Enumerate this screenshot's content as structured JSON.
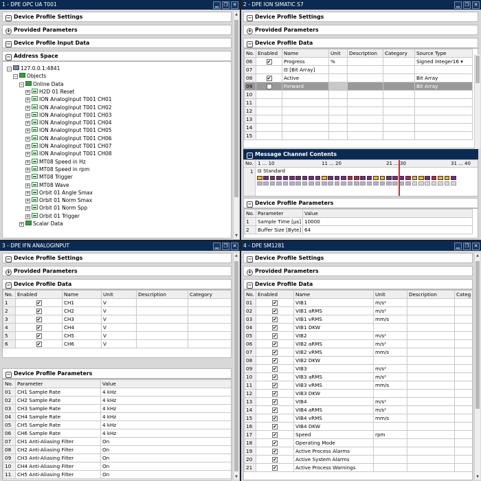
{
  "p1": {
    "title": "1 - DPE OPC UA T001",
    "sections": [
      "Device Profile Settings",
      "Provided Parameters",
      "Device Profile Input Data",
      "Address Space"
    ],
    "tree": [
      {
        "label": "127.0.0.1:4841",
        "level": 0,
        "expander": "−",
        "icon": "server-icon"
      },
      {
        "label": "Objects",
        "level": 1,
        "expander": "−",
        "icon": "folder-icon"
      },
      {
        "label": "Online Data",
        "level": 2,
        "expander": "−",
        "icon": "folder-icon"
      },
      {
        "label": "H2D 01 Reset",
        "level": 3,
        "expander": "+",
        "icon": "variable-icon"
      },
      {
        "label": "ION AnalogInput T001 CH01",
        "level": 3,
        "expander": "+",
        "icon": "variable-icon"
      },
      {
        "label": "ION AnalogInput T001 CH02",
        "level": 3,
        "expander": "+",
        "icon": "variable-icon"
      },
      {
        "label": "ION AnalogInput T001 CH03",
        "level": 3,
        "expander": "+",
        "icon": "variable-icon"
      },
      {
        "label": "ION AnalogInput T001 CH04",
        "level": 3,
        "expander": "+",
        "icon": "variable-icon"
      },
      {
        "label": "ION AnalogInput T001 CH05",
        "level": 3,
        "expander": "+",
        "icon": "variable-icon"
      },
      {
        "label": "ION AnalogInput T001 CH06",
        "level": 3,
        "expander": "+",
        "icon": "variable-icon"
      },
      {
        "label": "ION AnalogInput T001 CH07",
        "level": 3,
        "expander": "+",
        "icon": "variable-icon"
      },
      {
        "label": "ION AnalogInput T001 CH08",
        "level": 3,
        "expander": "+",
        "icon": "variable-icon"
      },
      {
        "label": "MT08 Speed in Hz",
        "level": 3,
        "expander": "+",
        "icon": "variable-icon"
      },
      {
        "label": "MT08 Speed in rpm",
        "level": 3,
        "expander": "+",
        "icon": "variable-icon"
      },
      {
        "label": "MT08 Trigger",
        "level": 3,
        "expander": "+",
        "icon": "variable-icon"
      },
      {
        "label": "MT08 Wave",
        "level": 3,
        "expander": "+",
        "icon": "variable-icon"
      },
      {
        "label": "Orbit 01 Angle Smax",
        "level": 3,
        "expander": "+",
        "icon": "variable-icon"
      },
      {
        "label": "Orbit 01 Norm Smax",
        "level": 3,
        "expander": "+",
        "icon": "variable-icon"
      },
      {
        "label": "Orbit 01 Norm Spp",
        "level": 3,
        "expander": "+",
        "icon": "variable-icon"
      },
      {
        "label": "Orbit 01 Trigger",
        "level": 3,
        "expander": "+",
        "icon": "variable-icon"
      },
      {
        "label": "Scalar Data",
        "level": 2,
        "expander": "+",
        "icon": "folder-icon"
      }
    ]
  },
  "p2": {
    "title": "2 - DPE ION SIMATIC S7",
    "sections": [
      "Device Profile Settings",
      "Provided Parameters",
      "Device Profile Data",
      "Message Channel Contents",
      "Device Profile Parameters"
    ],
    "headers": [
      "No.",
      "Enabled",
      "Name",
      "Unit",
      "Description",
      "Category",
      "Source Type"
    ],
    "rows": [
      {
        "no": "06",
        "enabled": true,
        "name": "Progress",
        "unit": "%",
        "desc": "",
        "cat": "",
        "src": "Signed Integer16 ▾"
      },
      {
        "no": "07",
        "enabled": false,
        "name": "⊟ [Bit Array]",
        "unit": "",
        "desc": "",
        "cat": "",
        "src": ""
      },
      {
        "no": "08",
        "enabled": true,
        "name": "Active",
        "unit": "",
        "desc": "",
        "cat": "",
        "src": "Bit Array"
      },
      {
        "no": "09",
        "enabled": true,
        "name": "Forward",
        "unit": "",
        "desc": "",
        "cat": "",
        "src": "Bit Array",
        "selected": true
      },
      {
        "no": "10",
        "enabled": false,
        "name": "",
        "unit": "",
        "desc": "",
        "cat": "",
        "src": ""
      },
      {
        "no": "11",
        "enabled": false,
        "name": "",
        "unit": "",
        "desc": "",
        "cat": "",
        "src": ""
      },
      {
        "no": "12",
        "enabled": false,
        "name": "",
        "unit": "",
        "desc": "",
        "cat": "",
        "src": ""
      },
      {
        "no": "13",
        "enabled": false,
        "name": "",
        "unit": "",
        "desc": "",
        "cat": "",
        "src": ""
      },
      {
        "no": "14",
        "enabled": false,
        "name": "",
        "unit": "",
        "desc": "",
        "cat": "",
        "src": ""
      },
      {
        "no": "15",
        "enabled": false,
        "name": "",
        "unit": "",
        "desc": "",
        "cat": "",
        "src": ""
      }
    ],
    "channel": {
      "no_label": "No.",
      "ranges": [
        "1 ... 10",
        "11 ... 20",
        "21 ... 30",
        "31 ... 40"
      ],
      "row_no": "1",
      "row_label": "⊟ Standard"
    },
    "param_headers": [
      "No.",
      "Parameter",
      "Value"
    ],
    "params": [
      {
        "no": "1",
        "param": "Sample Time [µs]",
        "value": "10000"
      },
      {
        "no": "2",
        "param": "Buffer Size [Byte]",
        "value": "64"
      }
    ]
  },
  "p3": {
    "title": "3 - DPE IFN ANALOGINPUT",
    "sections": [
      "Device Profile Settings",
      "Provided Parameters",
      "Device Profile Data",
      "Device Profile Parameters"
    ],
    "headers": [
      "No.",
      "Enabled",
      "Name",
      "Unit",
      "Description",
      "Category"
    ],
    "rows": [
      {
        "no": "1",
        "name": "CH1",
        "unit": "V"
      },
      {
        "no": "2",
        "name": "CH2",
        "unit": "V"
      },
      {
        "no": "3",
        "name": "CH3",
        "unit": "V"
      },
      {
        "no": "4",
        "name": "CH4",
        "unit": "V"
      },
      {
        "no": "5",
        "name": "CH5",
        "unit": "V"
      },
      {
        "no": "6",
        "name": "CH6",
        "unit": "V"
      }
    ],
    "param_headers": [
      "No.",
      "Parameter",
      "Value"
    ],
    "params": [
      {
        "no": "01",
        "param": "CH1 Sample Rate",
        "value": "4 kHz"
      },
      {
        "no": "02",
        "param": "CH2 Sample Rate",
        "value": "4 kHz"
      },
      {
        "no": "03",
        "param": "CH3 Sample Rate",
        "value": "4 kHz"
      },
      {
        "no": "04",
        "param": "CH4 Sample Rate",
        "value": "4 kHz"
      },
      {
        "no": "05",
        "param": "CH5 Sample Rate",
        "value": "4 kHz"
      },
      {
        "no": "06",
        "param": "CH6 Sample Rate",
        "value": "4 kHz"
      },
      {
        "no": "07",
        "param": "CH1 Anti-Aliasing Filter",
        "value": "On"
      },
      {
        "no": "08",
        "param": "CH2 Anti-Aliasing Filter",
        "value": "On"
      },
      {
        "no": "09",
        "param": "CH3 Anti-Aliasing Filter",
        "value": "On"
      },
      {
        "no": "10",
        "param": "CH4 Anti-Aliasing Filter",
        "value": "On"
      },
      {
        "no": "11",
        "param": "CH5 Anti-Aliasing Filter",
        "value": "On"
      }
    ]
  },
  "p4": {
    "title": "4 - DPE SM1281",
    "sections": [
      "Device Profile Settings",
      "Provided Parameters",
      "Device Profile Data"
    ],
    "headers": [
      "No.",
      "Enabled",
      "Name",
      "Unit",
      "Description",
      "Categ"
    ],
    "rows": [
      {
        "no": "01",
        "name": "VIB1",
        "unit": "m/s²"
      },
      {
        "no": "02",
        "name": "VIB1 aRMS",
        "unit": "m/s²"
      },
      {
        "no": "03",
        "name": "VIB1 vRMS",
        "unit": "mm/s"
      },
      {
        "no": "04",
        "name": "VIB1 DKW",
        "unit": ""
      },
      {
        "no": "05",
        "name": "VIB2",
        "unit": "m/s²"
      },
      {
        "no": "06",
        "name": "VIB2 aRMS",
        "unit": "m/s²"
      },
      {
        "no": "07",
        "name": "VIB2 vRMS",
        "unit": "mm/s"
      },
      {
        "no": "08",
        "name": "VIB2 DKW",
        "unit": ""
      },
      {
        "no": "09",
        "name": "VIB3",
        "unit": "m/s²"
      },
      {
        "no": "10",
        "name": "VIB3 aRMS",
        "unit": "m/s²"
      },
      {
        "no": "11",
        "name": "VIB3 vRMS",
        "unit": "mm/s"
      },
      {
        "no": "12",
        "name": "VIB3 DKW",
        "unit": ""
      },
      {
        "no": "13",
        "name": "VIB4",
        "unit": "m/s²"
      },
      {
        "no": "14",
        "name": "VIB4 aRMS",
        "unit": "m/s²"
      },
      {
        "no": "15",
        "name": "VIB4 vRMS",
        "unit": "mm/s"
      },
      {
        "no": "16",
        "name": "VIB4 DKW",
        "unit": ""
      },
      {
        "no": "17",
        "name": "Speed",
        "unit": "rpm"
      },
      {
        "no": "18",
        "name": "Operating Mode",
        "unit": ""
      },
      {
        "no": "19",
        "name": "Active Process Alarms",
        "unit": ""
      },
      {
        "no": "20",
        "name": "Active System Alarms",
        "unit": ""
      },
      {
        "no": "21",
        "name": "Active Process Warnings",
        "unit": ""
      }
    ]
  },
  "window_controls": {
    "minimize": "▁",
    "restore": "❐",
    "close": "✕"
  },
  "colors": {
    "title_bar": "#0b2a52",
    "selection": "#999999",
    "timeline_marker": "#e0202a",
    "tree_icon": "#3e9a49"
  }
}
